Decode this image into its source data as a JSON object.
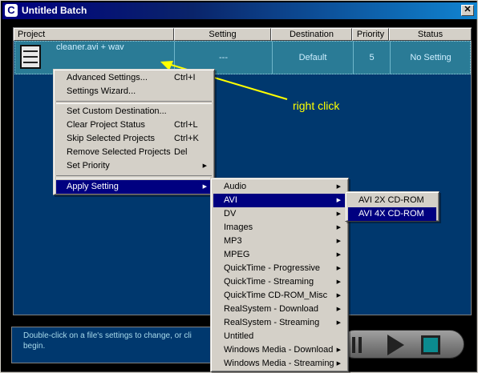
{
  "window": {
    "title": "Untitled Batch",
    "icon": "cleaner-logo-icon",
    "close_label": "✕"
  },
  "table": {
    "columns": [
      "Project",
      "Setting",
      "Destination",
      "Priority",
      "Status"
    ],
    "row": {
      "project": "cleaner.avi + wav",
      "setting": "---",
      "destination": "Default",
      "priority": "5",
      "status": "No Setting"
    }
  },
  "status_text": "Double-click on a file's settings to change, or cli\nbegin.",
  "context_menu": {
    "items": [
      {
        "label": "Advanced Settings...",
        "shortcut": "Ctrl+I"
      },
      {
        "label": "Settings Wizard...",
        "shortcut": ""
      },
      {
        "label": "Set Custom Destination...",
        "shortcut": ""
      },
      {
        "label": "Clear Project Status",
        "shortcut": "Ctrl+L"
      },
      {
        "label": "Skip Selected Projects",
        "shortcut": "Ctrl+K"
      },
      {
        "label": "Remove Selected Projects",
        "shortcut": "Del"
      },
      {
        "label": "Set Priority",
        "shortcut": ""
      },
      {
        "label": "Apply Setting",
        "shortcut": ""
      }
    ]
  },
  "apply_setting_menu": {
    "items": [
      {
        "label": "Audio"
      },
      {
        "label": "AVI"
      },
      {
        "label": "DV"
      },
      {
        "label": "Images"
      },
      {
        "label": "MP3"
      },
      {
        "label": "MPEG"
      },
      {
        "label": "QuickTime - Progressive"
      },
      {
        "label": "QuickTime - Streaming"
      },
      {
        "label": "QuickTime CD-ROM_Misc"
      },
      {
        "label": "RealSystem - Download"
      },
      {
        "label": "RealSystem - Streaming"
      },
      {
        "label": "Untitled"
      },
      {
        "label": "Windows Media - Download"
      },
      {
        "label": "Windows Media - Streaming"
      }
    ]
  },
  "avi_menu": {
    "items": [
      {
        "label": "AVI 2X CD-ROM"
      },
      {
        "label": "AVI 4X CD-ROM"
      }
    ]
  },
  "annotation": {
    "text": "right click",
    "color": "#ffff00"
  },
  "colors": {
    "title_bar": "#000080",
    "panel_bg": "#00386e",
    "selected_row": "#2a7b96",
    "menu_highlight": "#000080"
  }
}
